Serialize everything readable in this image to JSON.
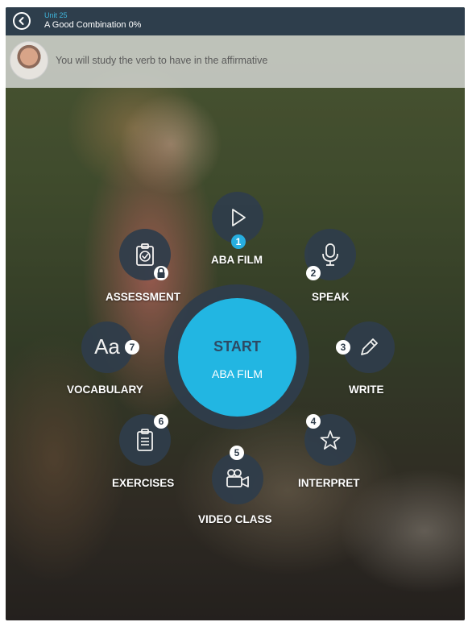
{
  "header": {
    "unit_label": "Unit 25",
    "unit_title": "A Good Combination 0%",
    "back_icon": "back-arrow-icon"
  },
  "info": {
    "message": "You will study the verb to have in the affirmative",
    "avatar": "teacher-avatar"
  },
  "center": {
    "start_label": "START",
    "start_sub": "ABA FILM",
    "accent_color": "#22b6e2",
    "ring_color": "#2f3d4b"
  },
  "menu": {
    "items": [
      {
        "number": "1",
        "label": "ABA FILM",
        "icon": "play-icon"
      },
      {
        "number": "2",
        "label": "SPEAK",
        "icon": "microphone-icon"
      },
      {
        "number": "3",
        "label": "WRITE",
        "icon": "pencil-icon"
      },
      {
        "number": "4",
        "label": "INTERPRET",
        "icon": "star-icon"
      },
      {
        "number": "5",
        "label": "VIDEO CLASS",
        "icon": "video-camera-icon"
      },
      {
        "number": "6",
        "label": "EXERCISES",
        "icon": "clipboard-icon"
      },
      {
        "number": "7",
        "label": "VOCABULARY",
        "icon": "aa-text-icon",
        "glyph": "Aa"
      },
      {
        "label": "ASSESSMENT",
        "icon": "assessment-clipboard-icon",
        "locked": true
      }
    ]
  }
}
